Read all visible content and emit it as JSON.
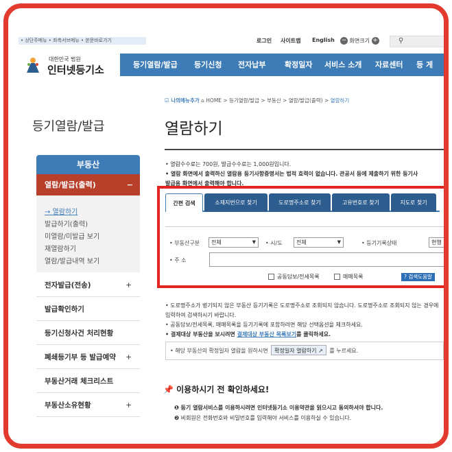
{
  "skip_links": "• 상단주메뉴 • 좌측서브메뉴 • 본문바로가기",
  "util": {
    "login": "로그인",
    "sitemap": "사이트맵",
    "english": "English",
    "zoom": "화면크기"
  },
  "logo": {
    "sub": "대한민국 법원",
    "main": "인터넷등기소"
  },
  "gnb": [
    "등기열람/발급",
    "등기신청",
    "전자납부",
    "확정일자",
    "서비스 소개",
    "자료센터",
    "등 게"
  ],
  "sidebar": {
    "title": "등기열람/발급",
    "tab": "부동산",
    "active": "열람/발급(출력)",
    "active_sign": "−",
    "subitems": [
      "→ 열람하기",
      "발급하기(출력)",
      "미열람/미발급 보기",
      "재열람하기",
      "열람/발급내역 보기"
    ],
    "items": [
      {
        "label": "전자발급(전송)",
        "sign": "+"
      },
      {
        "label": "발급확인하기",
        "sign": ""
      },
      {
        "label": "등기신청사건 처리현황",
        "sign": ""
      },
      {
        "label": "폐쇄등기부 등 발급예약",
        "sign": "+"
      },
      {
        "label": "부동산거래 체크리스트",
        "sign": ""
      },
      {
        "label": "부동산소유현황",
        "sign": "+"
      }
    ]
  },
  "breadcrumb": {
    "my": "나의메뉴추가",
    "path": "HOME > 등기열람/발급 > 부동산 > 열람/발급(출력) >",
    "current": "열람하기"
  },
  "page_title": "열람하기",
  "notes": [
    "• 열람수수료는 700원, 발급수수료는 1,000원입니다.",
    "• 열람 화면에서 출력하신 열람용 등기사항증명서는 법적 효력이 없습니다. 관공서 등에 제출하기 위한 등기사",
    "  발급용 화면에서 출력해야 합니다."
  ],
  "tabs": [
    "간편 검색",
    "소재지번으로 찾기",
    "도로명주소로 찾기",
    "고유번호로 찾기",
    "지도로 찾기"
  ],
  "form": {
    "type_label": "• 부동산구분",
    "type_value": "전체",
    "sido_label": "• 시/도",
    "sido_value": "전체",
    "status_label": "• 등기기록상태",
    "status_value": "현행",
    "addr_label": "• 주 소",
    "chk1": "공동담보/전세목록",
    "chk2": "매매목록",
    "help": "? 검색도움말"
  },
  "lower_notes": [
    "• 도로명주소가 병기되지 않은 부동산 등기기록은 도로명주소로 조회되지 않습니다. 도로명주소로 조회되지 않는 경우에",
    "  입력하여 검색하시기 바랍니다.",
    "• 공동담보/전세목록, 매매목록을 등기기록에 포함하려면 해당 선택옵션을 체크하세요."
  ],
  "lower_note_link": {
    "pre": "• 결제대상 부동산을 보시려면 ",
    "link": "결제대상 부동산 목록보기",
    "post": "를 클릭하세요."
  },
  "infobox": {
    "pre": "• 해당 부동산의 확정일자 열람을 원하시면",
    "button": "확정일자 열람하기 ↗",
    "post": "를 누르세요."
  },
  "confirm_title": "이용하시기 전 확인하세요!",
  "bottom_notes": [
    "❶ 등기 열람서비스를 이용하시려면 인터넷등기소 이용약관을 읽으시고 동의하셔야 합니다.",
    "❷ 비회원은 전화번호와 비밀번호를 입력해야 서비스를 이용하실 수 있습니다."
  ],
  "colors": {
    "frame": "#e23a2e",
    "nav": "#3e7cb8",
    "active": "#b8402a",
    "highlight": "#e0261e"
  }
}
